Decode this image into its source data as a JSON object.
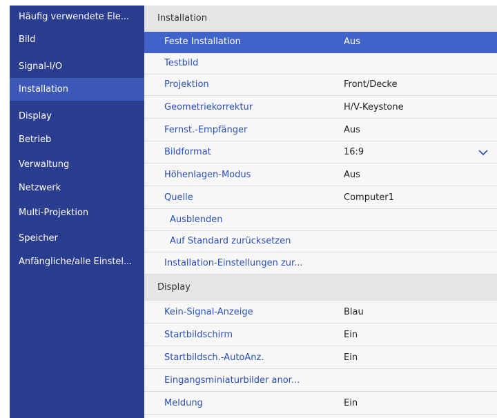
{
  "sidebar": {
    "items": [
      {
        "label": "Häufig verwendete Ele..."
      },
      {
        "label": "Bild"
      },
      {
        "label": "Signal-I/O"
      },
      {
        "label": "Installation"
      },
      {
        "label": "Display"
      },
      {
        "label": "Betrieb"
      },
      {
        "label": "Verwaltung"
      },
      {
        "label": "Netzwerk"
      },
      {
        "label": "Multi-Projektion"
      },
      {
        "label": "Speicher"
      },
      {
        "label": "Anfängliche/alle Einstel..."
      }
    ],
    "active_index": 3
  },
  "sections": {
    "installation": {
      "title": "Installation",
      "rows": [
        {
          "label": "Feste Installation",
          "value": "Aus"
        },
        {
          "label": "Testbild",
          "value": ""
        },
        {
          "label": "Projektion",
          "value": "Front/Decke"
        },
        {
          "label": "Geometriekorrektur",
          "value": "H/V-Keystone"
        },
        {
          "label": "Fernst.-Empfänger",
          "value": "Aus"
        },
        {
          "label": "Bildformat",
          "value": "16:9",
          "icon": "chevron-down-icon"
        },
        {
          "label": "Höhenlagen-Modus",
          "value": "Aus"
        },
        {
          "label": "Quelle",
          "value": "Computer1"
        },
        {
          "label": "Ausblenden",
          "value": ""
        },
        {
          "label": "Auf Standard zurücksetzen",
          "value": ""
        },
        {
          "label": "Installation-Einstellungen zur...",
          "value": ""
        }
      ]
    },
    "display": {
      "title": "Display",
      "rows": [
        {
          "label": "Kein-Signal-Anzeige",
          "value": "Blau"
        },
        {
          "label": "Startbildschirm",
          "value": "Ein"
        },
        {
          "label": "Startbildsch.-AutoAnz.",
          "value": "Ein"
        },
        {
          "label": "Eingangsminiaturbilder anor...",
          "value": ""
        },
        {
          "label": "Meldung",
          "value": "Ein"
        }
      ]
    }
  },
  "colors": {
    "sidebar_bg": "#2a3d8f",
    "sidebar_active": "#3d59b8",
    "row_selected": "#3f63c9",
    "label_text": "#2b4fb8"
  }
}
